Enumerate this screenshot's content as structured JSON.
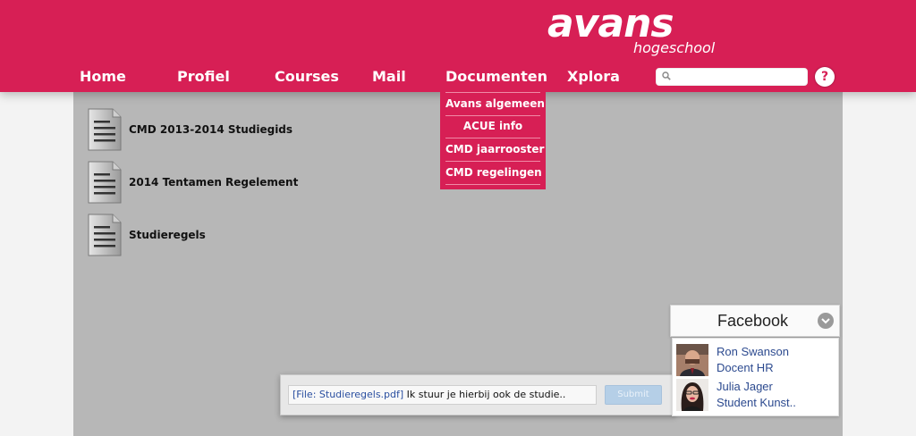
{
  "header": {
    "logo_main": "avans",
    "logo_sub": "hogeschool",
    "nav": [
      "Home",
      "Profiel",
      "Courses",
      "Mail",
      "Documenten",
      "Xplora"
    ],
    "search": {
      "value": "",
      "placeholder": ""
    },
    "help_label": "?"
  },
  "dropdown": {
    "items": [
      "Avans algemeen",
      "ACUE info",
      "CMD jaarrooster",
      "CMD regelingen"
    ]
  },
  "documents": [
    {
      "label": "CMD 2013-2014 Studiegids",
      "icon": "document-icon"
    },
    {
      "label": "2014 Tentamen Regelement",
      "icon": "document-icon"
    },
    {
      "label": "Studieregels",
      "icon": "document-icon"
    }
  ],
  "chat": {
    "file_ref": "[File: Studieregels.pdf]",
    "message": " Ik stuur je hierbij ook de studie..",
    "submit_label": "Submit"
  },
  "facebook": {
    "title": "Facebook",
    "contacts": [
      {
        "name": "Ron Swanson",
        "role": "Docent HR"
      },
      {
        "name": "Julia Jager",
        "role": "Student Kunst.."
      }
    ]
  },
  "colors": {
    "brand": "#d71f55",
    "content_bg": "#b7b7b7",
    "link": "#2c4a8f"
  }
}
